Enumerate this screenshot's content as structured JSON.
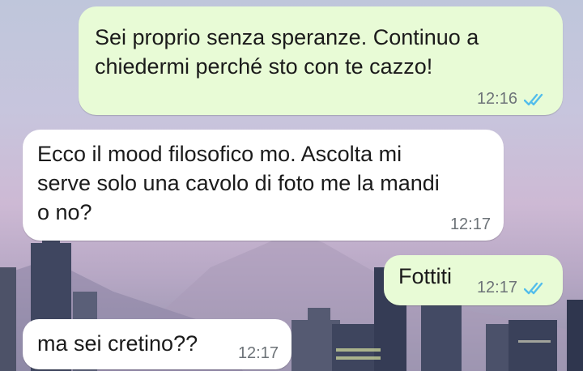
{
  "theme": {
    "outgoing_bubble": "#e8fbd6",
    "incoming_bubble": "#ffffff",
    "read_ticks": "#53bdeb",
    "meta_text": "#6d7378"
  },
  "messages": [
    {
      "direction": "outgoing",
      "text": "Sei proprio senza speranze. Continuo a\nchiedermi perché sto con te cazzo!",
      "time": "12:16",
      "status_icon": "double-check-read-icon"
    },
    {
      "direction": "incoming",
      "text": "Ecco il mood filosofico mo. Ascolta mi\nserve solo una cavolo di foto me la mandi\no no?",
      "time": "12:17"
    },
    {
      "direction": "outgoing",
      "text": "Fottiti",
      "time": "12:17",
      "status_icon": "double-check-read-icon"
    },
    {
      "direction": "incoming",
      "text": "ma sei cretino??",
      "time": "12:17"
    }
  ]
}
